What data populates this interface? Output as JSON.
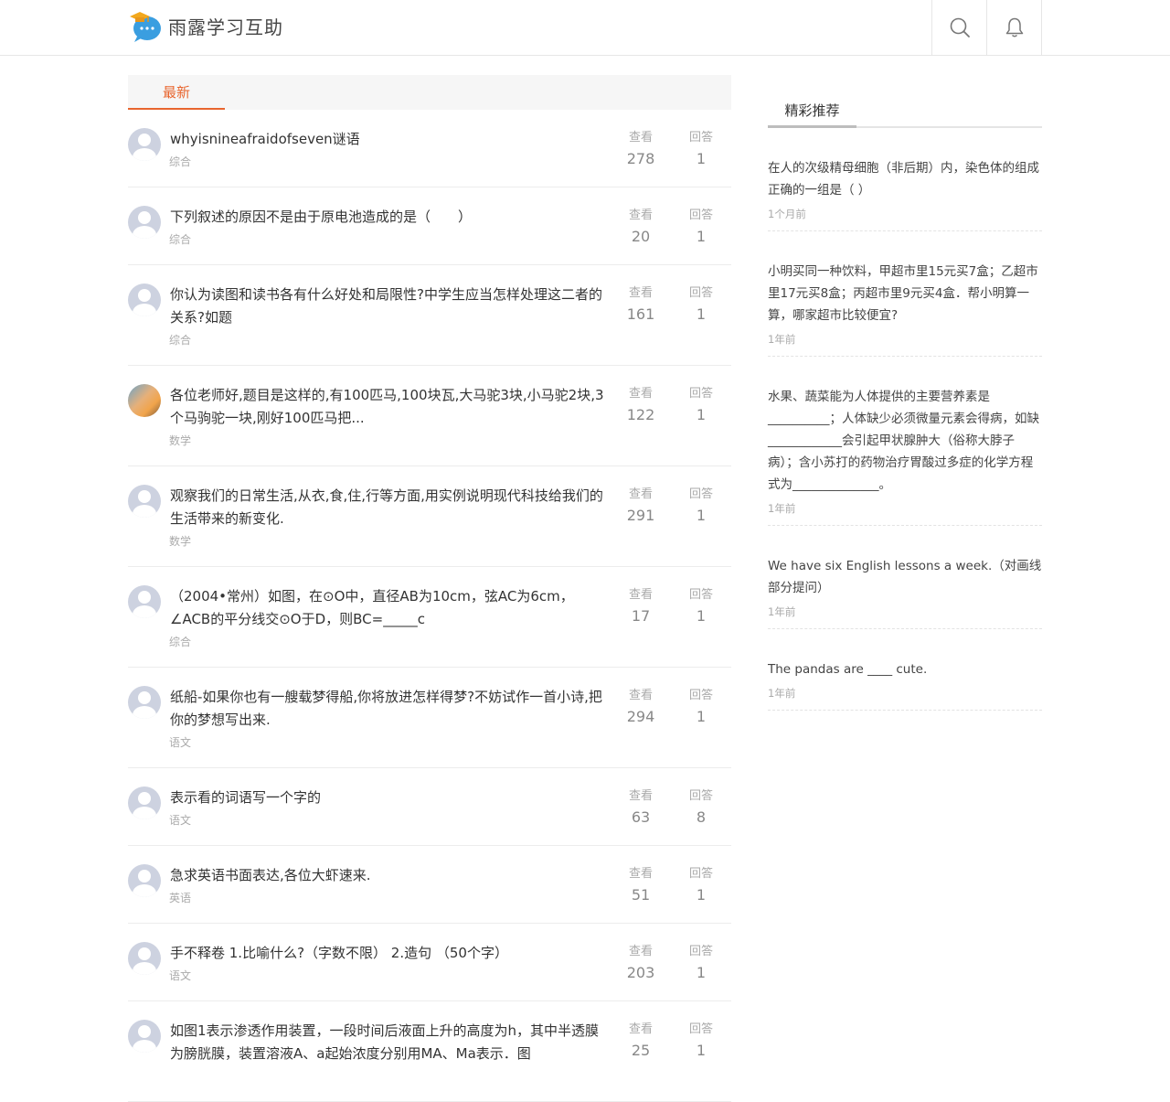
{
  "header": {
    "site_name": "雨露学习互助"
  },
  "main": {
    "tab_label": "最新",
    "views_label": "查看",
    "answers_label": "回答",
    "questions": [
      {
        "title": "whyisnineafraidofseven谜语",
        "category": "综合",
        "views": "278",
        "answers": "1",
        "avatar": "default"
      },
      {
        "title": "下列叙述的原因不是由于原电池造成的是（　　）",
        "category": "综合",
        "views": "20",
        "answers": "1",
        "avatar": "default"
      },
      {
        "title": "你认为读图和读书各有什么好处和局限性?中学生应当怎样处理这二者的关系?如题",
        "category": "综合",
        "views": "161",
        "answers": "1",
        "avatar": "default"
      },
      {
        "title": "各位老师好,题目是这样的,有100匹马,100块瓦,大马驼3块,小马驼2块,3个马驹驼一块,刚好100匹马把...",
        "category": "数学",
        "views": "122",
        "answers": "1",
        "avatar": "photo"
      },
      {
        "title": "观察我们的日常生活,从衣,食,住,行等方面,用实例说明现代科技给我们的生活带来的新变化.",
        "category": "数学",
        "views": "291",
        "answers": "1",
        "avatar": "default"
      },
      {
        "title": "（2004•常州）如图，在⊙O中，直径AB为10cm，弦AC为6cm，∠ACB的平分线交⊙O于D，则BC=_____c",
        "category": "综合",
        "views": "17",
        "answers": "1",
        "avatar": "default"
      },
      {
        "title": "纸船-如果你也有一艘载梦得船,你将放进怎样得梦?不妨试作一首小诗,把你的梦想写出来.",
        "category": "语文",
        "views": "294",
        "answers": "1",
        "avatar": "default"
      },
      {
        "title": "表示看的词语写一个字的",
        "category": "语文",
        "views": "63",
        "answers": "8",
        "avatar": "default"
      },
      {
        "title": "急求英语书面表达,各位大虾速来.",
        "category": "英语",
        "views": "51",
        "answers": "1",
        "avatar": "default"
      },
      {
        "title": "手不释卷 1.比喻什么?（字数不限） 2.造句 （50个字）",
        "category": "语文",
        "views": "203",
        "answers": "1",
        "avatar": "default"
      },
      {
        "title": "如图1表示渗透作用装置，一段时间后液面上升的高度为h，其中半透膜为膀胱膜，装置溶液A、a起始浓度分别用MA、Ma表示．图",
        "category": "",
        "views": "25",
        "answers": "1",
        "avatar": "default"
      }
    ]
  },
  "sidebar": {
    "title": "精彩推荐",
    "items": [
      {
        "title": "在人的次级精母细胞（非后期）内，染色体的组成正确的一组是（ ）",
        "time": "1个月前"
      },
      {
        "title": "小明买同一种饮料，甲超市里15元买7盒；乙超市里17元买8盒；丙超市里9元买4盒．帮小明算一算，哪家超市比较便宜?",
        "time": "1年前"
      },
      {
        "title": "水果、蔬菜能为人体提供的主要营养素是__________；人体缺少必须微量元素会得病，如缺____________会引起甲状腺肿大（俗称大脖子病）；含小苏打的药物治疗胃酸过多症的化学方程式为______________。",
        "time": "1年前"
      },
      {
        "title": "We have six English lessons a week.（对画线部分提问）",
        "time": "1年前"
      },
      {
        "title": "The pandas are ____ cute.",
        "time": "1年前"
      }
    ]
  }
}
